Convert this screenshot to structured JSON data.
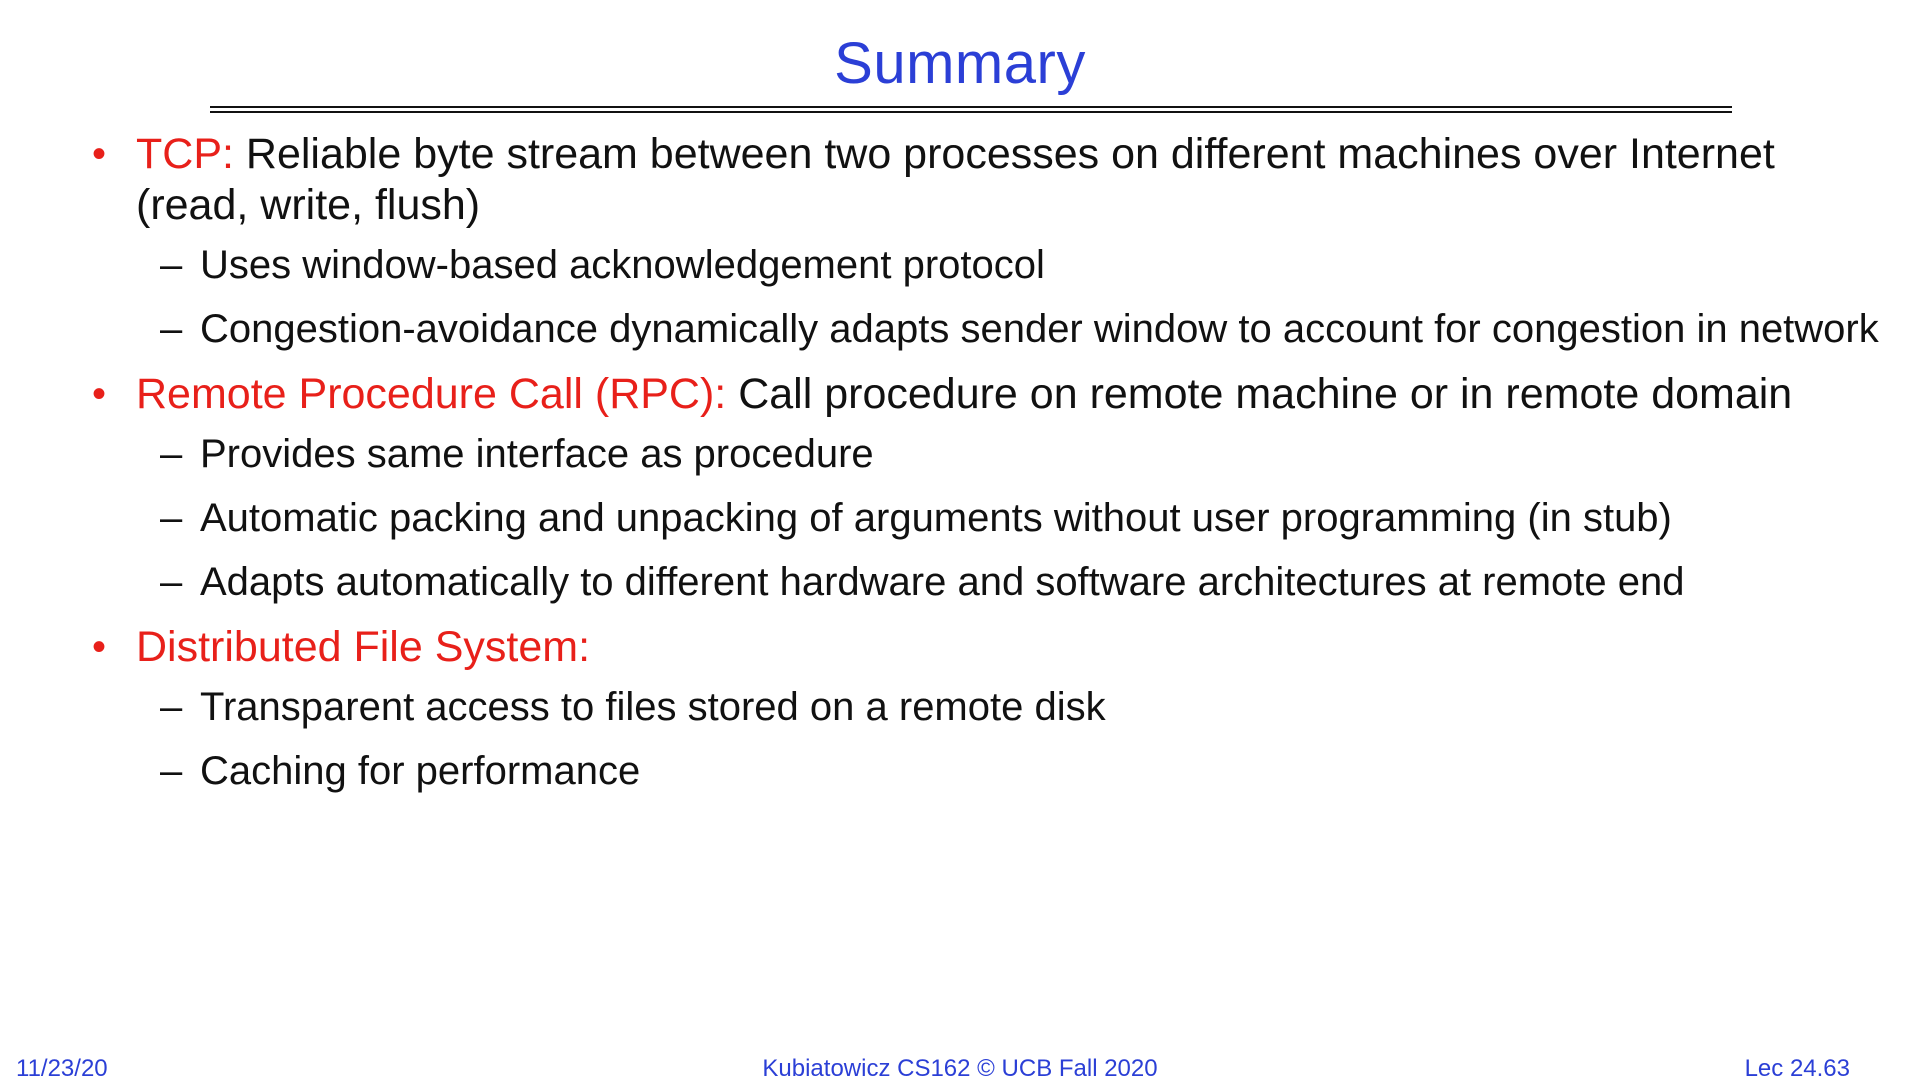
{
  "slide": {
    "title": "Summary",
    "bullets": [
      {
        "lead": "TCP:",
        "text": " Reliable byte stream between two processes on different machines over Internet (read, write, flush)",
        "subs": [
          "Uses window-based acknowledgement protocol",
          "Congestion-avoidance dynamically adapts sender window to account for congestion in network"
        ]
      },
      {
        "lead": "Remote Procedure Call (RPC):",
        "text": " Call procedure on remote machine or in remote domain",
        "subs": [
          "Provides same interface as procedure",
          "Automatic packing and unpacking of arguments without user programming (in stub)",
          "Adapts automatically to different hardware and software architectures at remote end"
        ]
      },
      {
        "lead": "Distributed File System:",
        "text": "",
        "subs": [
          "Transparent access to files stored on a remote disk",
          "Caching for performance"
        ]
      }
    ],
    "bullet_glyph": "•",
    "dash_glyph": "–"
  },
  "footer": {
    "date": "11/23/20",
    "course": "Kubiatowicz CS162 © UCB Fall 2020",
    "lecture": "Lec 24.63"
  },
  "colors": {
    "title": "#2b3fd6",
    "lead": "#e8201a",
    "body": "#111111",
    "footer": "#2b3fd6"
  }
}
